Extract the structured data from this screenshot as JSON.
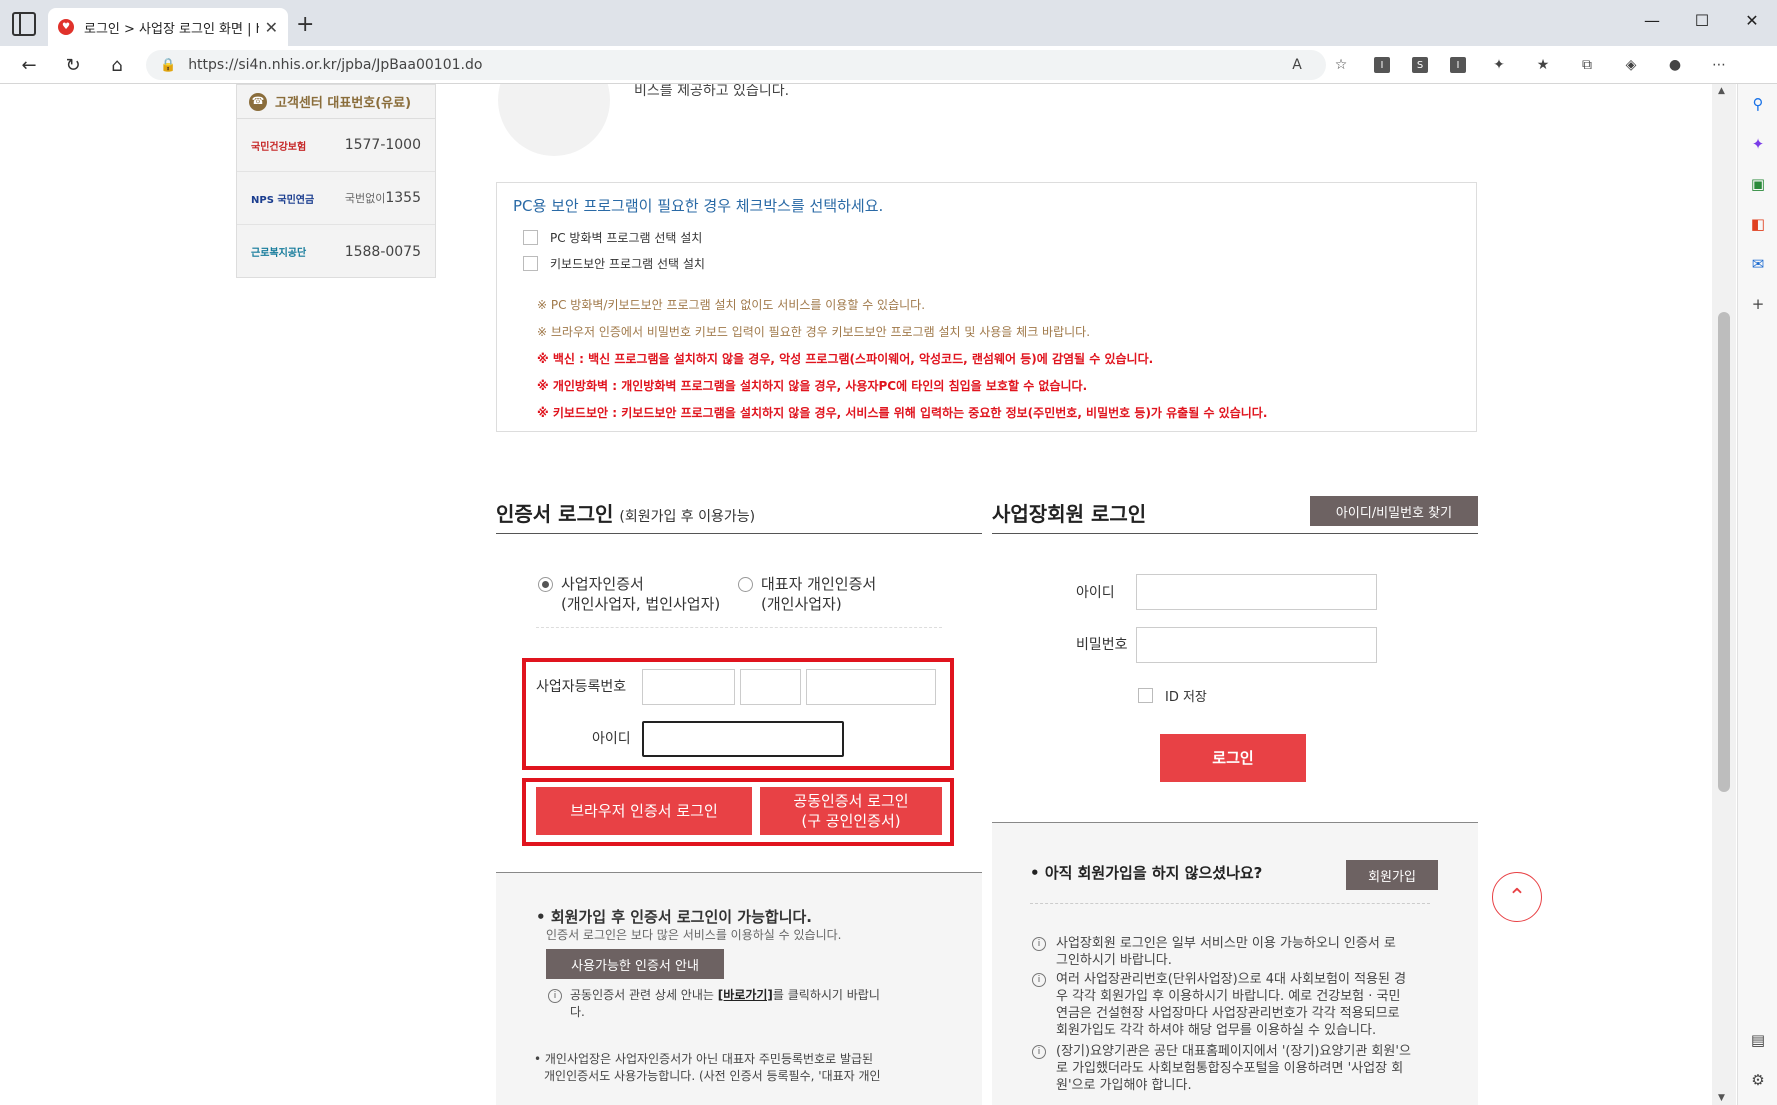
{
  "browser": {
    "tab_title": "로그인 > 사업장 로그인 화면 | h",
    "url": "https://si4n.nhis.or.kr/jpba/JpBaa00101.do"
  },
  "customer_center": {
    "title": "고객센터 대표번호(유료)",
    "rows": [
      {
        "org": "국민건강보험",
        "number": "1577-1000",
        "prefix": ""
      },
      {
        "org": "NPS 국민연금",
        "number": "1355",
        "prefix": "국번없이"
      },
      {
        "org": "근로복지공단",
        "number": "1588-0075",
        "prefix": ""
      }
    ]
  },
  "top_text": "비스를 제공하고 있습니다.",
  "security": {
    "title": "PC용 보안 프로그램이 필요한 경우 체크박스를 선택하세요.",
    "checkboxes": [
      "PC 방화벽 프로그램 선택 설치",
      "키보드보안 프로그램 선택 설치"
    ],
    "notes_gray": [
      "※ PC 방화벽/키보드보안 프로그램 설치 없이도 서비스를 이용할 수 있습니다.",
      "※ 브라우저 인증에서 비밀번호 키보드 입력이 필요한 경우 키보드보안 프로그램 설치 및 사용을 체크 바랍니다."
    ],
    "notes_red": [
      "※ 백신 : 백신 프로그램을 설치하지 않을 경우, 악성 프로그램(스파이웨어, 악성코드, 랜섬웨어 등)에 감염될 수 있습니다.",
      "※ 개인방화벽 : 개인방화벽 프로그램을 설치하지 않을 경우, 사용자PC에 타인의 침입을 보호할 수 없습니다.",
      "※ 키보드보안 : 키보드보안 프로그램을 설치하지 않을 경우, 서비스를 위해 입력하는 중요한 정보(주민번호, 비밀번호 등)가 유출될 수 있습니다."
    ]
  },
  "cert_login": {
    "title": "인증서 로그인",
    "subtitle": "(회원가입 후 이용가능)",
    "radio1_line1": "사업자인증서",
    "radio1_line2": "(개인사업자, 법인사업자)",
    "radio2_line1": "대표자 개인인증서",
    "radio2_line2": "(개인사업자)",
    "biz_no_label": "사업자등록번호",
    "id_label": "아이디",
    "browser_cert_btn": "브라우저 인증서 로그인",
    "joint_cert_btn_line1": "공동인증서 로그인",
    "joint_cert_btn_line2": "(구 공인인증서)"
  },
  "cert_info": {
    "heading": "회원가입 후 인증서 로그인이 가능합니다.",
    "sub": "인증서 로그인은 보다 많은 서비스를 이용하실 수 있습니다.",
    "btn": "사용가능한 인증서 안내",
    "info1_pre": "공동인증서 관련 상세 안내는 ",
    "info1_link": "[바로가기]",
    "info1_post": "를 클릭하시기 바랍니",
    "info1_wrap": "다.",
    "bottom1": "• 개인사업장은 사업자인증서가 아닌 대표자 주민등록번호로 발급된",
    "bottom2": "개인인증서도 사용가능합니다. (사전 인증서 등록필수, '대표자 개인"
  },
  "member_login": {
    "title": "사업장회원 로그인",
    "find_btn": "아이디/비밀번호 찾기",
    "id_label": "아이디",
    "pw_label": "비밀번호",
    "save_id": "ID 저장",
    "login_btn": "로그인"
  },
  "join_info": {
    "heading": "아직 회원가입을 하지 않으셨나요?",
    "join_btn": "회원가입",
    "items": [
      [
        "사업장회원 로그인은 일부 서비스만 이용 가능하오니 인증서 로",
        "그인하시기 바랍니다."
      ],
      [
        "여러 사업장관리번호(단위사업장)으로 4대 사회보험이 적용된 경",
        "우 각각 회원가입 후 이용하시기 바랍니다. 예로 건강보험 · 국민",
        "연금은 건설현장 사업장마다 사업장관리번호가 각각 적용되므로",
        "회원가입도 각각 하셔야 해당 업무를 이용하실 수 있습니다."
      ],
      [
        "(장기)요양기관은 공단 대표홈페이지에서 '(장기)요양기관 회원'으",
        "로 가입했더라도 사회보험통합징수포털을 이용하려면 '사업장 회",
        "원'으로 가입해야 합니다."
      ]
    ]
  }
}
